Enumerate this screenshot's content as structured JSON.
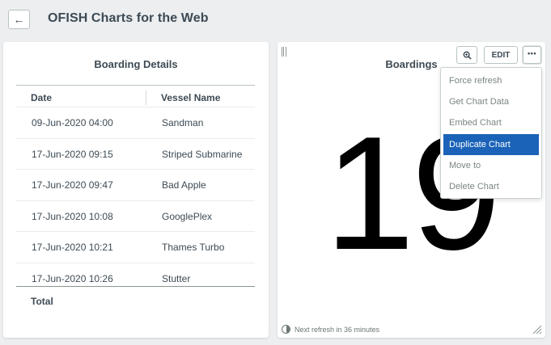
{
  "header": {
    "back_glyph": "←",
    "title": "OFISH Charts for the Web"
  },
  "left_chart": {
    "title": "Boarding Details",
    "columns": [
      "Date",
      "Vessel Name"
    ],
    "rows": [
      {
        "date": "09-Jun-2020 04:00",
        "vessel": "Sandman"
      },
      {
        "date": "17-Jun-2020 09:15",
        "vessel": "Striped Submarine"
      },
      {
        "date": "17-Jun-2020 09:47",
        "vessel": "Bad Apple"
      },
      {
        "date": "17-Jun-2020 10:08",
        "vessel": "GooglePlex"
      },
      {
        "date": "17-Jun-2020 10:21",
        "vessel": "Thames Turbo"
      },
      {
        "date": "17-Jun-2020 10:26",
        "vessel": "Stutter"
      }
    ],
    "total_label": "Total"
  },
  "right_chart": {
    "title": "Boardings",
    "value": "19",
    "edit_label": "EDIT",
    "more_glyph": "•••",
    "footer": "Next refresh in 36 minutes"
  },
  "menu": {
    "items": [
      {
        "label": "Force refresh"
      },
      {
        "label": "Get Chart Data"
      },
      {
        "label": "Embed Chart"
      },
      {
        "label": "Duplicate Chart",
        "selected": true
      },
      {
        "label": "Move to"
      },
      {
        "label": "Delete Chart"
      }
    ]
  },
  "colors": {
    "background": "#eceef0",
    "card": "#ffffff",
    "text": "#3d4a54",
    "menu_selected": "#1a63b8"
  }
}
